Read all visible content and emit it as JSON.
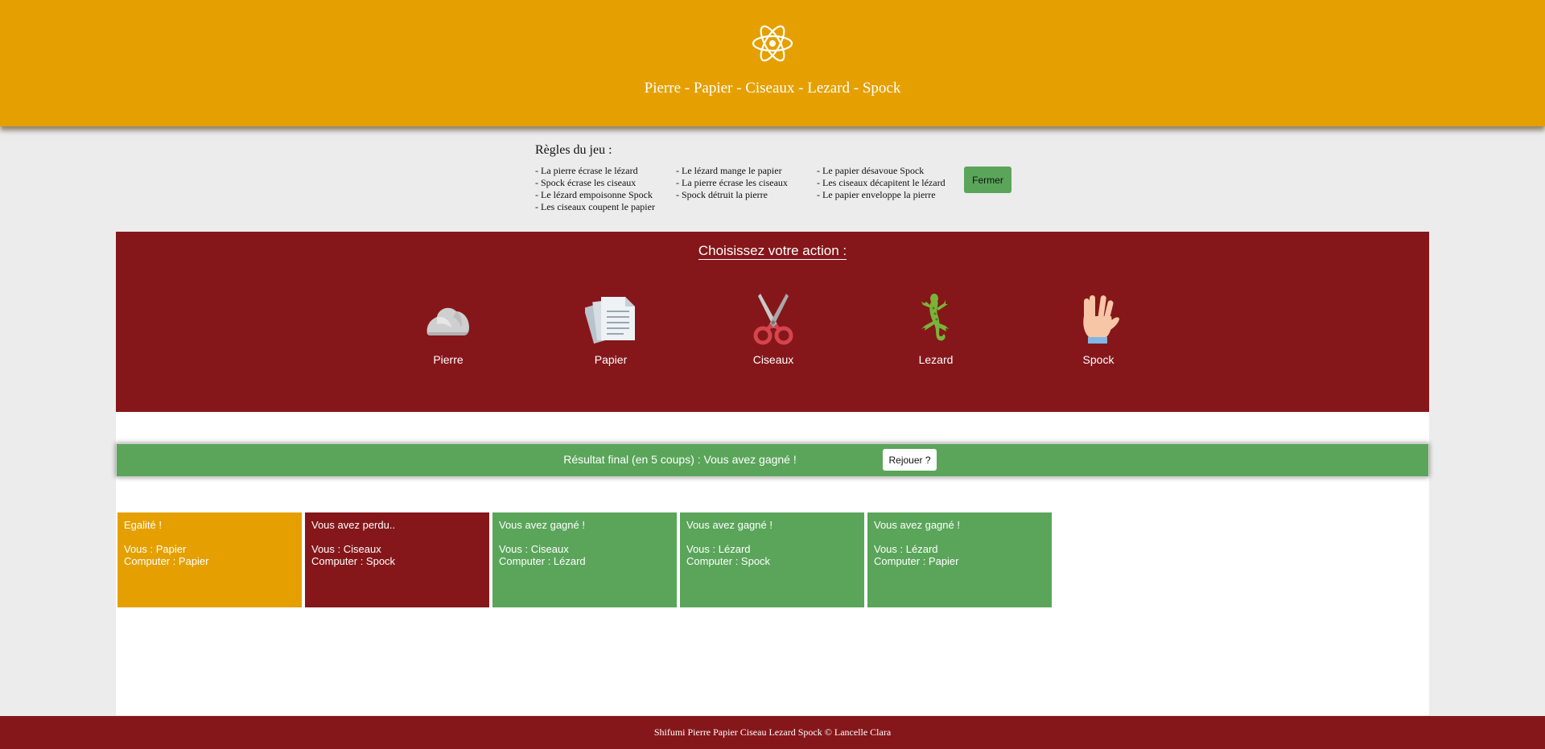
{
  "header": {
    "title": "Pierre - Papier - Ciseaux - Lezard - Spock",
    "logo_icon": "atom-icon"
  },
  "rules": {
    "title": "Règles du jeu :",
    "columns": [
      [
        "- La pierre écrase le lézard",
        "- Spock écrase les ciseaux",
        "- Le lézard empoisonne Spock",
        "- Les ciseaux coupent le papier"
      ],
      [
        "- Le lézard mange le papier",
        "- La pierre écrase les ciseaux",
        "- Spock détruit la pierre"
      ],
      [
        "- Le papier désavoue Spock",
        "- Les ciseaux décapitent le lézard",
        "- Le papier enveloppe la pierre"
      ]
    ],
    "close_label": "Fermer"
  },
  "actions": {
    "title": "Choisissez votre action :",
    "items": [
      {
        "label": "Pierre",
        "icon": "rock-icon"
      },
      {
        "label": "Papier",
        "icon": "paper-icon"
      },
      {
        "label": "Ciseaux",
        "icon": "scissors-icon"
      },
      {
        "label": "Lezard",
        "icon": "lizard-icon"
      },
      {
        "label": "Spock",
        "icon": "spock-hand-icon"
      }
    ]
  },
  "result": {
    "text": "Résultat final (en 5 coups) : Vous avez gagné !",
    "replay_label": "Rejouer ?"
  },
  "rounds": [
    {
      "outcome": "Egalité !",
      "you": "Vous : Papier",
      "computer": "Computer : Papier",
      "color": "#e5a000"
    },
    {
      "outcome": "Vous avez perdu..",
      "you": "Vous : Ciseaux",
      "computer": "Computer : Spock",
      "color": "#85171a"
    },
    {
      "outcome": "Vous avez gagné !",
      "you": "Vous : Ciseaux",
      "computer": "Computer : Lézard",
      "color": "#5aa55a"
    },
    {
      "outcome": "Vous avez gagné !",
      "you": "Vous : Lézard",
      "computer": "Computer : Spock",
      "color": "#5aa55a"
    },
    {
      "outcome": "Vous avez gagné !",
      "you": "Vous : Lézard",
      "computer": "Computer : Papier",
      "color": "#5aa55a"
    }
  ],
  "footer": {
    "text": "Shifumi Pierre Papier Ciseau Lezard Spock © Lancelle Clara"
  },
  "colors": {
    "header": "#e5a000",
    "actions_bg": "#85171a",
    "win": "#5aa55a",
    "lose": "#85171a",
    "draw": "#e5a000"
  }
}
